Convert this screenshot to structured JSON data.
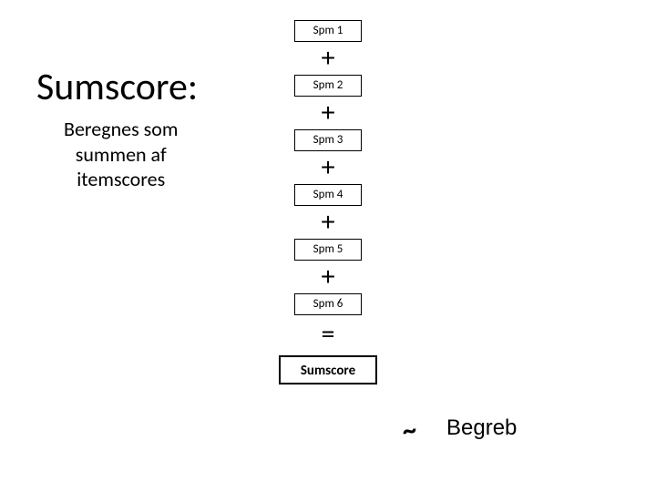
{
  "title": "Sumscore:",
  "subtitle": "Beregnes som\nsummen af\nitemscores",
  "items": {
    "0": "Spm 1",
    "1": "Spm 2",
    "2": "Spm 3",
    "3": "Spm 4",
    "4": "Spm 5",
    "5": "Spm 6"
  },
  "op_plus": "+",
  "op_eq": "=",
  "sum_label": "Sumscore",
  "tilde": "~",
  "concept": "Begreb"
}
